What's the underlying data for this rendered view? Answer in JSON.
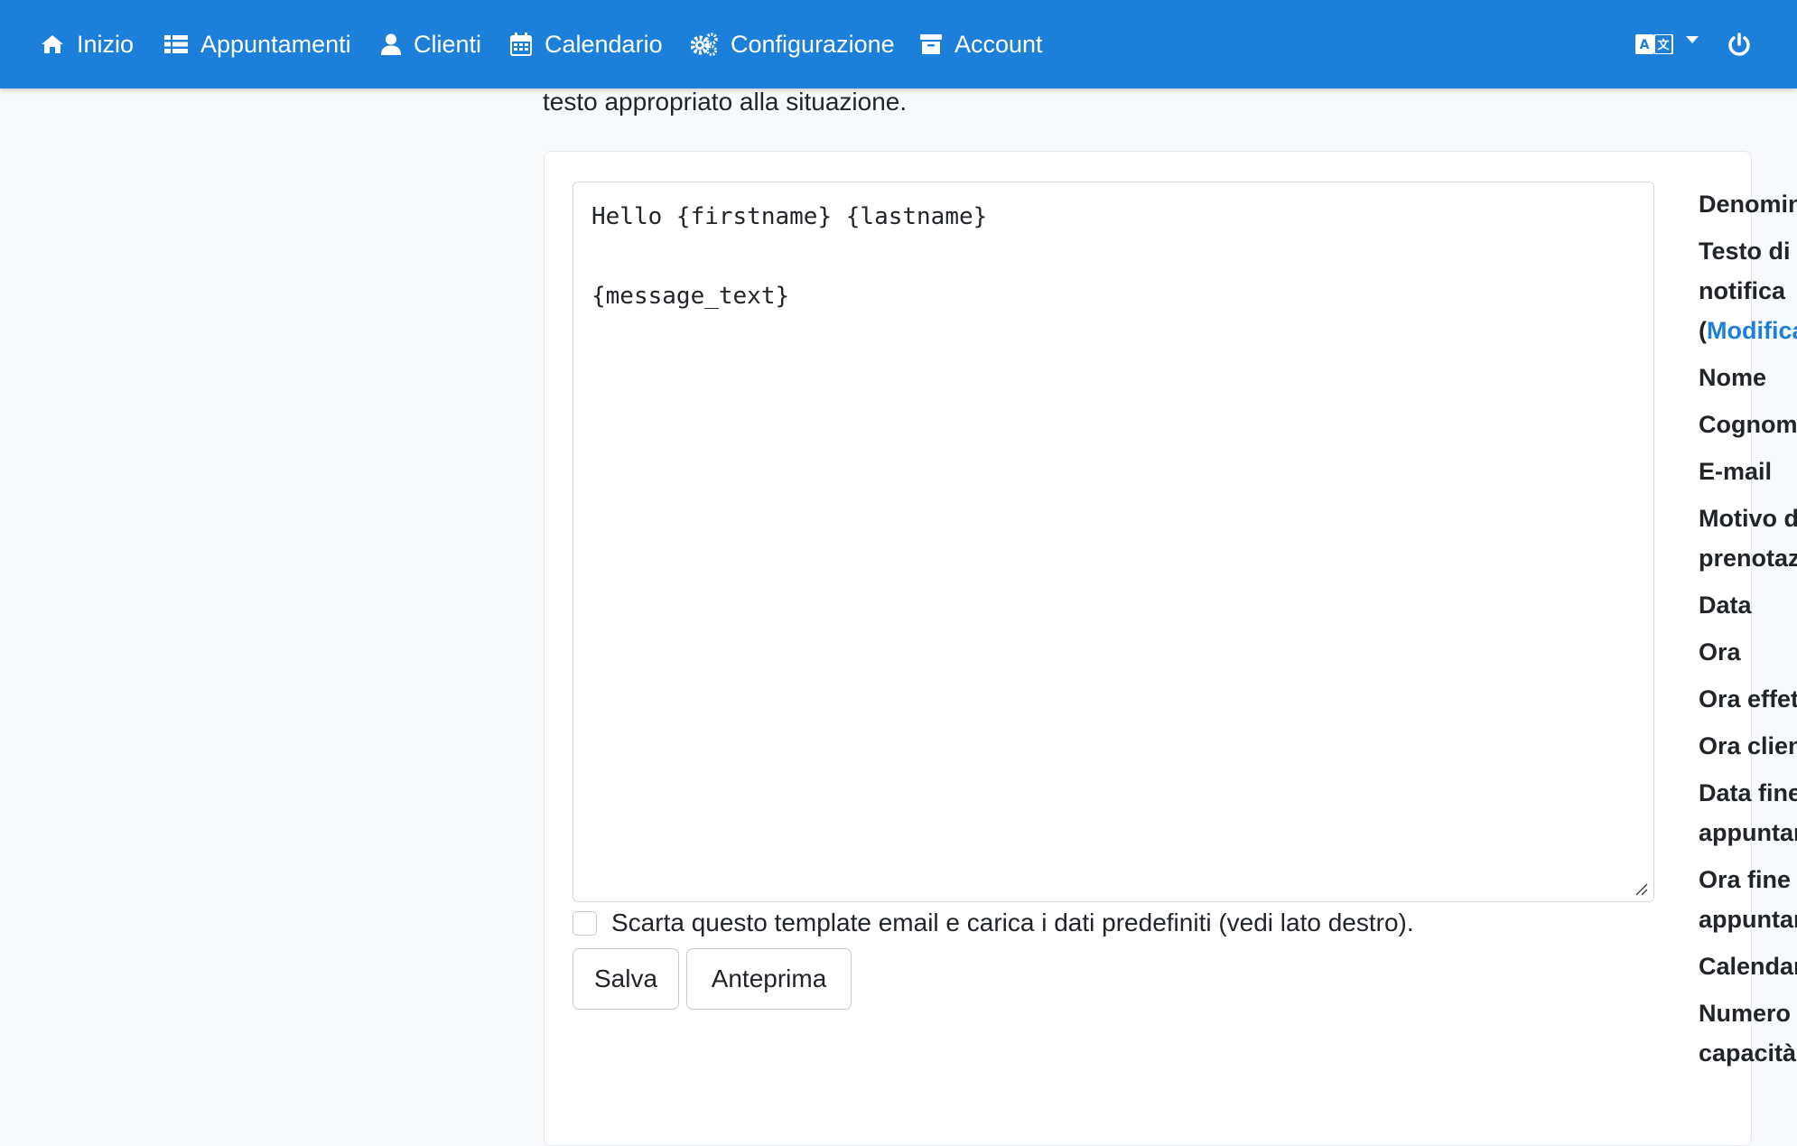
{
  "nav": {
    "items": [
      {
        "label": "Inizio",
        "icon": "home-icon"
      },
      {
        "label": "Appuntamenti",
        "icon": "list-icon"
      },
      {
        "label": "Clienti",
        "icon": "user-icon"
      },
      {
        "label": "Calendario",
        "icon": "calendar-icon"
      },
      {
        "label": "Configurazione",
        "icon": "cogs-icon"
      },
      {
        "label": "Account",
        "icon": "archive-icon"
      }
    ],
    "right_icons": [
      "language-icon",
      "caret-down-icon",
      "power-icon"
    ],
    "background": "#1c7fd9"
  },
  "intro_text": "testo appropriato alla situazione.",
  "editor": {
    "lines": [
      "Hello {firstname} {lastname}",
      "",
      "{message_text}"
    ]
  },
  "discard_checkbox": {
    "label": "Scarta questo template email e carica i dati predefiniti (vedi lato destro).",
    "checked": false
  },
  "buttons": {
    "save": "Salva",
    "preview": "Anteprima"
  },
  "variables": {
    "denomination": "Denominazione",
    "notification_text_1": "Testo di",
    "notification_text_2": "notifica",
    "edit_prefix": "(",
    "edit_link": "Modifica",
    "firstname": "Nome",
    "lastname": "Cognome",
    "email": "E-mail",
    "reason_1": "Motivo della",
    "reason_2": "prenotazione",
    "date": "Data",
    "time": "Ora",
    "effective_time": "Ora effettiva",
    "client_time": "Ora cliente",
    "end_date_1": "Data fine",
    "end_date_2": "appuntamento",
    "end_time_1": "Ora fine",
    "end_time_2": "appuntamento",
    "calendar": "Calendario",
    "capacity_1": "Numero",
    "capacity_2": "capacità"
  },
  "colors": {
    "accent": "#1c7fd9",
    "text": "#212529",
    "page_bg": "#f7f9fb"
  }
}
